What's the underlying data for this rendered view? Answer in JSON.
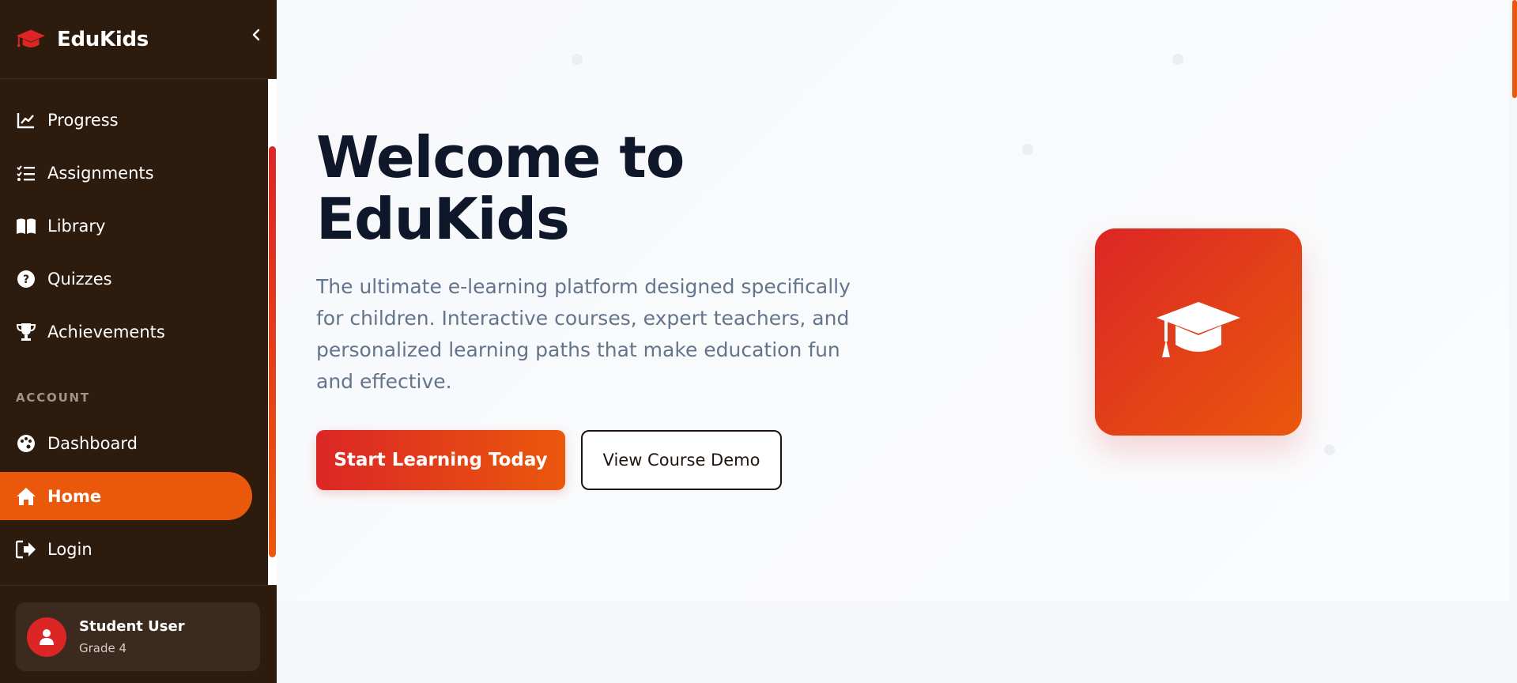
{
  "brand": {
    "name": "EduKids"
  },
  "nav": {
    "items": [
      {
        "label": "Progress",
        "icon": "chart-line-icon"
      },
      {
        "label": "Assignments",
        "icon": "list-check-icon"
      },
      {
        "label": "Library",
        "icon": "book-open-icon"
      },
      {
        "label": "Quizzes",
        "icon": "question-circle-icon"
      },
      {
        "label": "Achievements",
        "icon": "trophy-icon"
      }
    ],
    "section_label": "ACCOUNT",
    "account_items": [
      {
        "label": "Dashboard",
        "icon": "palette-icon"
      },
      {
        "label": "Home",
        "icon": "home-icon",
        "active": true
      },
      {
        "label": "Login",
        "icon": "sign-in-icon"
      }
    ]
  },
  "user": {
    "name": "Student User",
    "grade": "Grade 4"
  },
  "hero": {
    "title_line1": "Welcome to",
    "title_line2": "EduKids",
    "description": "The ultimate e-learning platform designed specifically for children. Interactive courses, expert teachers, and personalized learning paths that make education fun and effective.",
    "primary_button": "Start Learning Today",
    "secondary_button": "View Course Demo",
    "card_icon": "graduation-cap-icon"
  },
  "colors": {
    "sidebar_bg": "#2d1b0e",
    "accent": "#ea580c",
    "brand_red": "#dc2626",
    "title": "#0f172a",
    "body_text": "#64748b"
  }
}
